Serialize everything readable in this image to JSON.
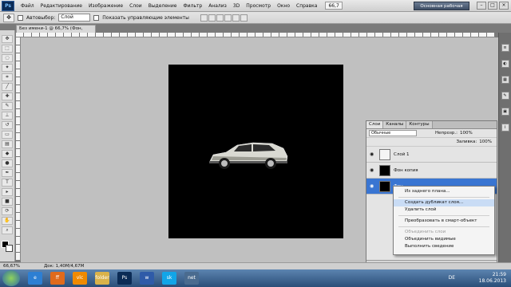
{
  "menubar": {
    "logo": "Ps",
    "items": [
      "Файл",
      "Редактирование",
      "Изображение",
      "Слои",
      "Выделение",
      "Фильтр",
      "Анализ",
      "3D",
      "Просмотр",
      "Окно",
      "Справка"
    ],
    "zoom": "66,7",
    "workspace": "Основная рабочая среда"
  },
  "options": {
    "auto_select_label": "Автовыбор:",
    "auto_select_value": "Слой",
    "show_controls_label": "Показать управляющие элементы"
  },
  "document": {
    "tab_title": "Без имени-1 @ 66,7% (Фон, RGB/8) *"
  },
  "status": {
    "zoom": "66,67%",
    "doc_size": "Док: 1,40М/4,67М"
  },
  "layers_panel": {
    "tabs": [
      "Слои",
      "Каналы",
      "Контуры"
    ],
    "blend_mode": "Обычные",
    "opacity_label": "Непрозр.:",
    "opacity_value": "100%",
    "fill_label": "Заливка:",
    "fill_value": "100%",
    "layers": [
      {
        "name": "Слой 1",
        "thumb": "white"
      },
      {
        "name": "Фон копия",
        "thumb": "black"
      },
      {
        "name": "Фон",
        "thumb": "black",
        "selected": true
      }
    ]
  },
  "context_menu": {
    "items": [
      {
        "label": "Из заднего плана...",
        "state": "normal"
      },
      {
        "label": "Создать дубликат слоя...",
        "state": "hover"
      },
      {
        "label": "Удалить слой",
        "state": "normal"
      },
      {
        "label": "Преобразовать в смарт-объект",
        "state": "normal"
      },
      {
        "label": "Объединить слои",
        "state": "disabled"
      },
      {
        "label": "Объединить видимые",
        "state": "normal"
      },
      {
        "label": "Выполнить сведение",
        "state": "normal"
      }
    ]
  },
  "taskbar": {
    "lang": "DE",
    "time": "21:59",
    "date": "18.06.2013",
    "apps": [
      "e",
      "ff",
      "vlc",
      "folder",
      "Ps",
      "w",
      "sk",
      "net"
    ]
  }
}
